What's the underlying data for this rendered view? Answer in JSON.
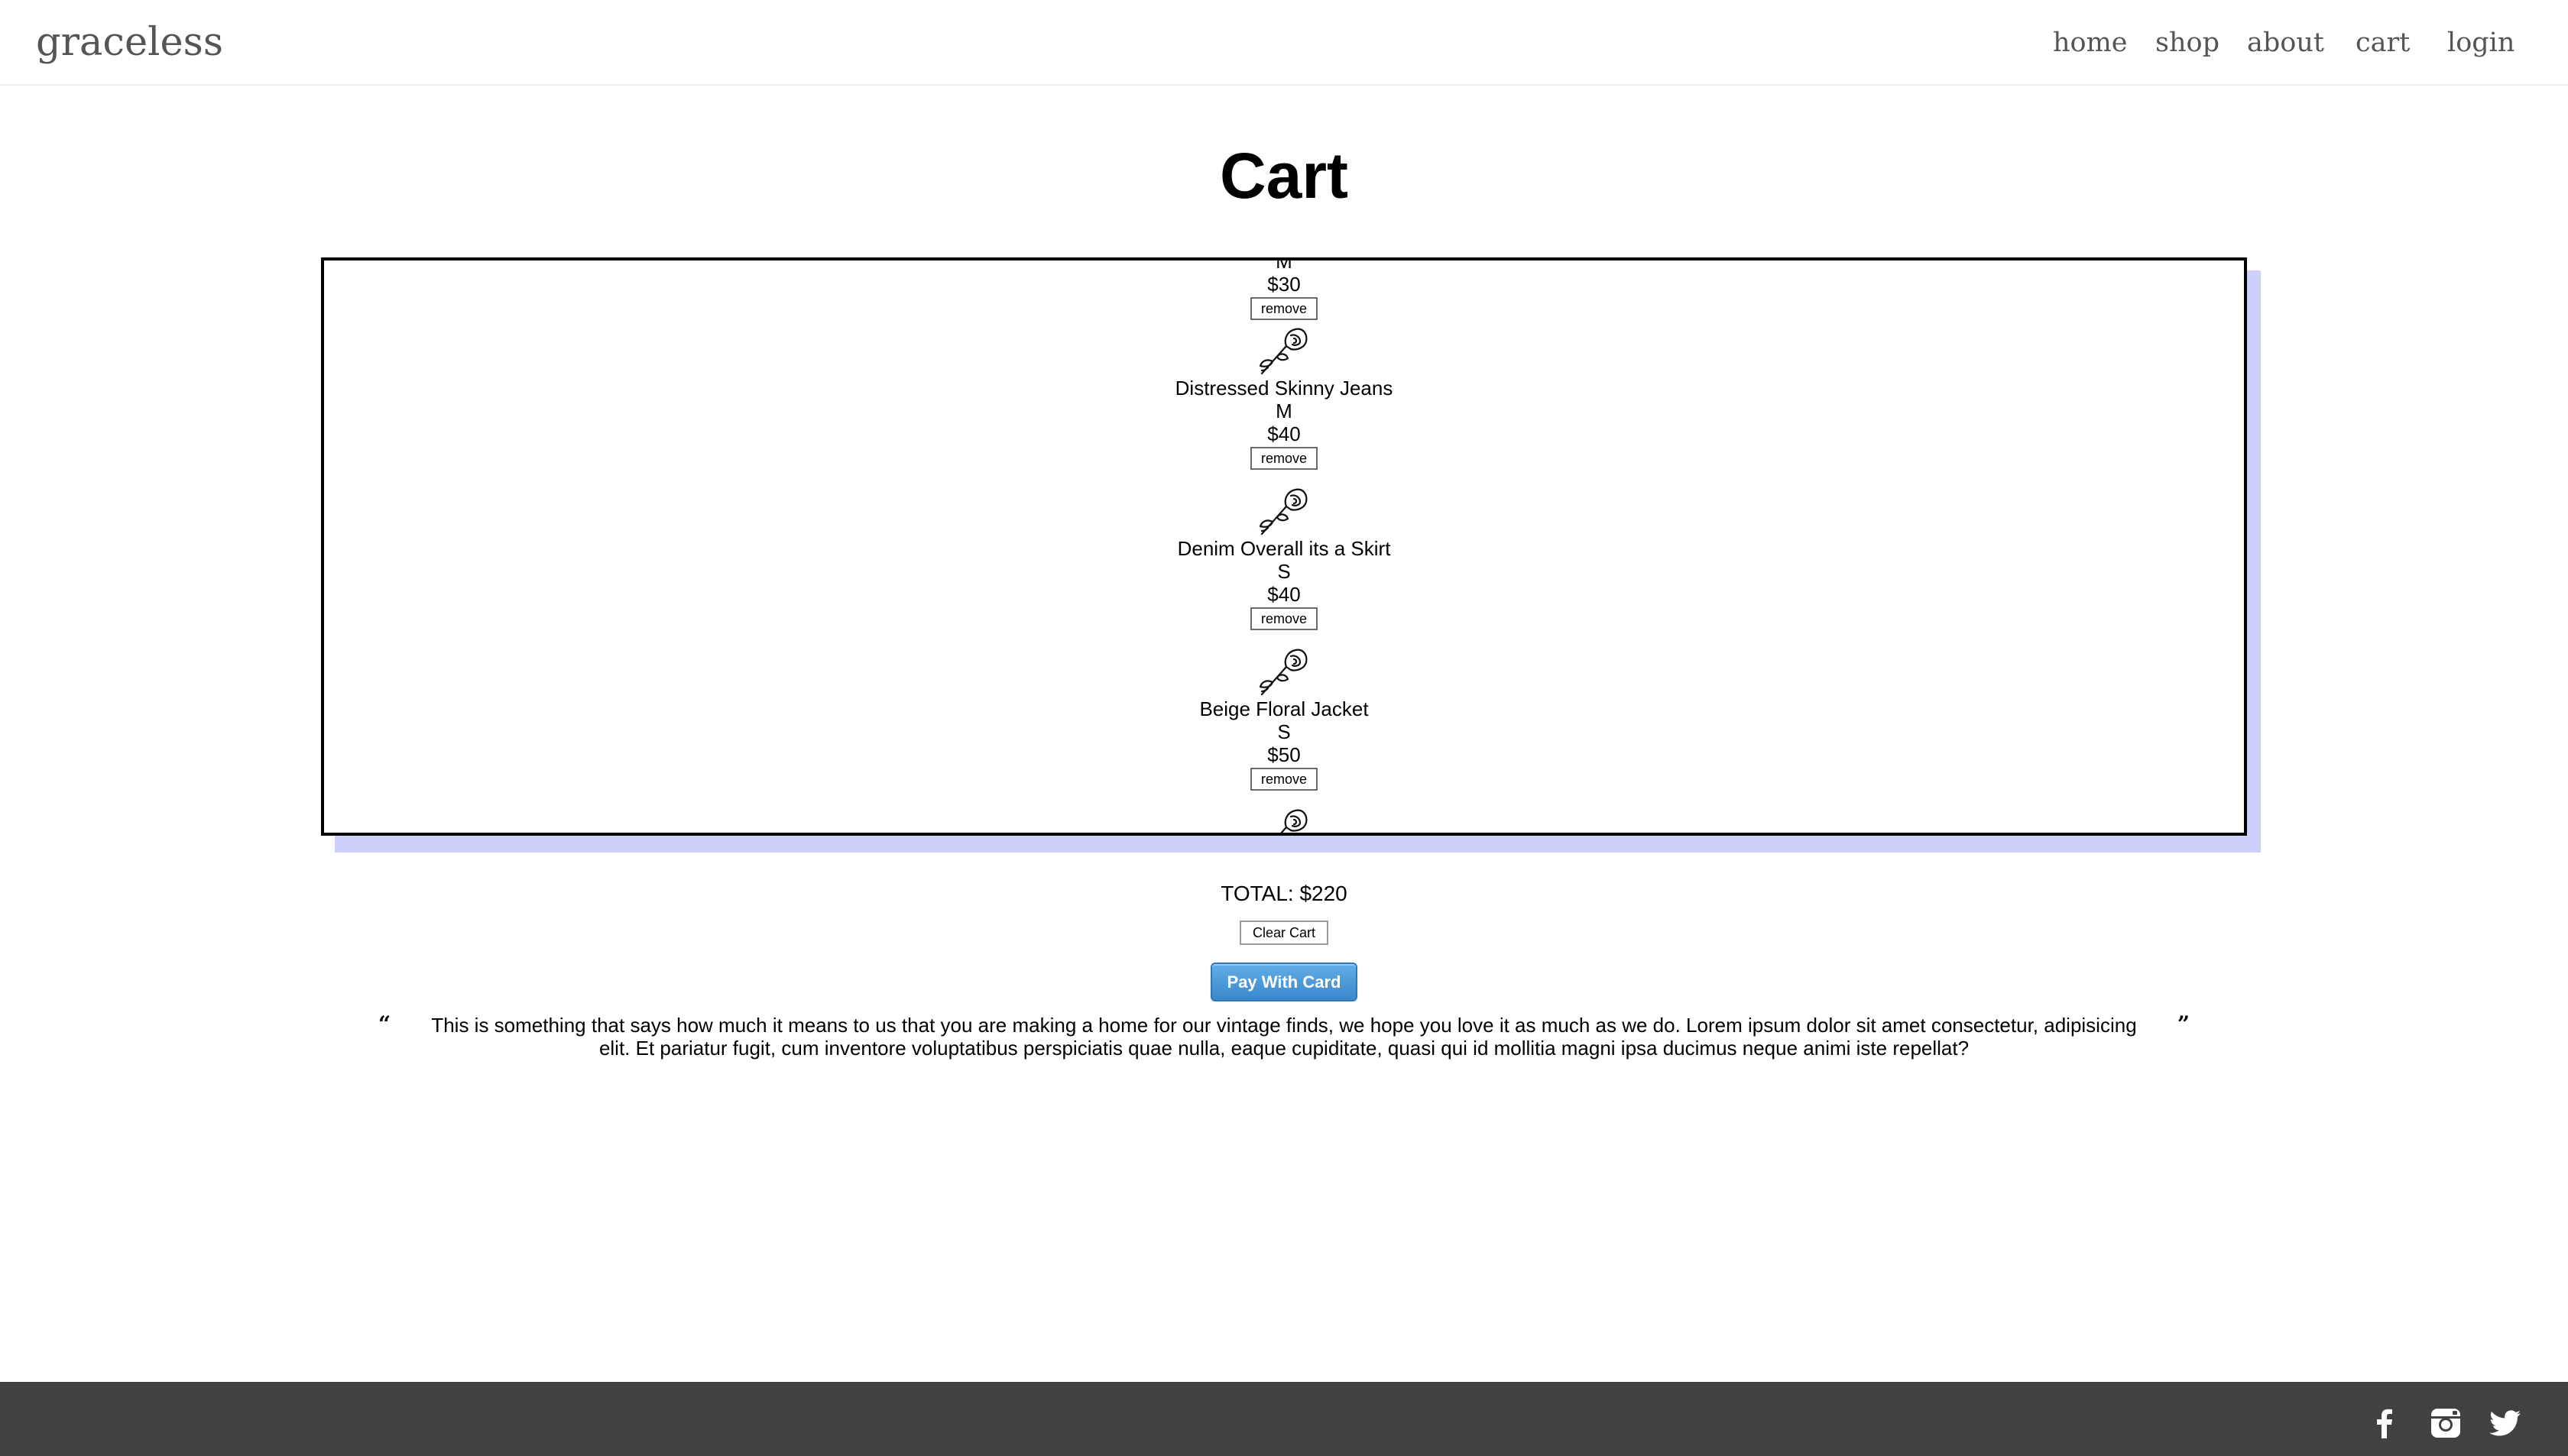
{
  "header": {
    "brand": "graceless",
    "nav": [
      {
        "label": "home"
      },
      {
        "label": "shop"
      },
      {
        "label": "about"
      },
      {
        "label": "cart"
      },
      {
        "label": "login"
      }
    ]
  },
  "page": {
    "title": "Cart"
  },
  "cart": {
    "partial_first_item": {
      "size": "M",
      "price": "$30",
      "remove_label": "remove"
    },
    "items": [
      {
        "name": "Distressed Skinny Jeans",
        "size": "M",
        "price": "$40",
        "remove_label": "remove"
      },
      {
        "name": "Denim Overall its a Skirt",
        "size": "S",
        "price": "$40",
        "remove_label": "remove"
      },
      {
        "name": "Beige Floral Jacket",
        "size": "S",
        "price": "$50",
        "remove_label": "remove"
      }
    ],
    "total": "TOTAL: $220",
    "clear_label": "Clear Cart",
    "pay_label": "Pay With Card"
  },
  "quote": {
    "text": "This is something that says how much it means to us that you are making a home for our vintage finds, we hope you love it as much as we do. Lorem ipsum dolor sit amet consectetur, adipisicing elit. Et pariatur fugit, cum inventore voluptatibus perspiciatis quae nulla, eaque cupiditate, quasi qui id mollitia magni ipsa ducimus neque animi iste repellat?"
  },
  "footer": {
    "social": [
      "facebook-icon",
      "instagram-icon",
      "twitter-icon"
    ]
  },
  "colors": {
    "footer_bg": "#414141",
    "cart_shadow": "#ccd0fb",
    "pay_button": "#3a87cc",
    "nav_text": "#555555"
  }
}
